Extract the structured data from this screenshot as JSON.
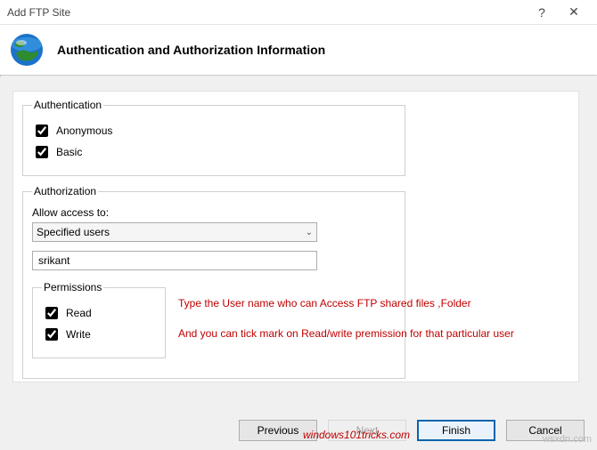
{
  "window": {
    "title": "Add FTP Site",
    "help_symbol": "?",
    "close_symbol": "✕"
  },
  "header": {
    "heading": "Authentication and Authorization Information"
  },
  "auth": {
    "legend": "Authentication",
    "anonymous_label": "Anonymous",
    "anonymous_checked": true,
    "basic_label": "Basic",
    "basic_checked": true
  },
  "authorization": {
    "legend": "Authorization",
    "allow_label": "Allow access to:",
    "selected_option": "Specified users",
    "user_value": "srikant",
    "permissions_legend": "Permissions",
    "read_label": "Read",
    "read_checked": true,
    "write_label": "Write",
    "write_checked": true
  },
  "annotations": {
    "line1": "Type the User name who can Access FTP shared files ,Folder",
    "line2": "And you can tick mark on Read/write premission for that particular user"
  },
  "buttons": {
    "previous": "Previous",
    "next": "Next",
    "finish": "Finish",
    "cancel": "Cancel"
  },
  "watermarks": {
    "w1": "windows101tricks.com",
    "w2": "wsxdn.com"
  }
}
